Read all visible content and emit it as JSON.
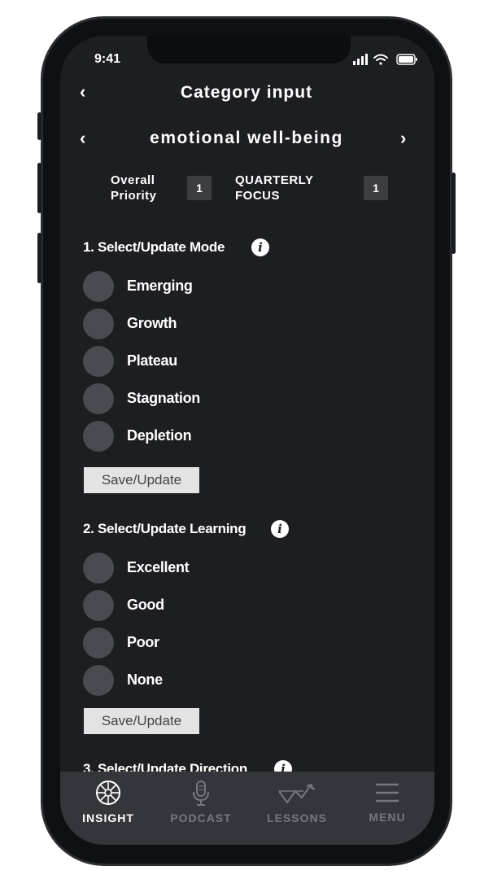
{
  "status_bar": {
    "time": "9:41"
  },
  "header": {
    "title": "Category input",
    "back_icon": "chevron-left-icon"
  },
  "category": {
    "name": "emotional well-being",
    "prev_icon": "chevron-left-icon",
    "next_icon": "chevron-right-icon"
  },
  "overall_priority": {
    "label_line1": "Overall",
    "label_line2": "Priority",
    "value": "1"
  },
  "quarterly_focus": {
    "label_line1": "QUARTERLY",
    "label_line2": "FOCUS",
    "value": "1"
  },
  "section1": {
    "title": "1. Select/Update Mode",
    "options": [
      "Emerging",
      "Growth",
      "Plateau",
      "Stagnation",
      "Depletion"
    ],
    "save_label": "Save/Update"
  },
  "section2": {
    "title": "2. Select/Update Learning",
    "options": [
      "Excellent",
      "Good",
      "Poor",
      "None"
    ],
    "save_label": "Save/Update"
  },
  "section3": {
    "title": "3. Select/Update Direction"
  },
  "tabbar": {
    "tabs": [
      {
        "label": "INSIGHT",
        "icon": "aperture-icon",
        "active": true
      },
      {
        "label": "PODCAST",
        "icon": "microphone-icon",
        "active": false
      },
      {
        "label": "LESSONS",
        "icon": "trend-chart-icon",
        "active": false
      },
      {
        "label": "MENU",
        "icon": "hamburger-menu-icon",
        "active": false
      }
    ]
  },
  "colors": {
    "screen_bg": "#1d1e21",
    "tabbar_bg": "#34363b",
    "radio_fill": "#4a4b50",
    "badge_bg": "#3c3d41",
    "active_tab": "#ffffff",
    "inactive_tab": "#75777c"
  }
}
